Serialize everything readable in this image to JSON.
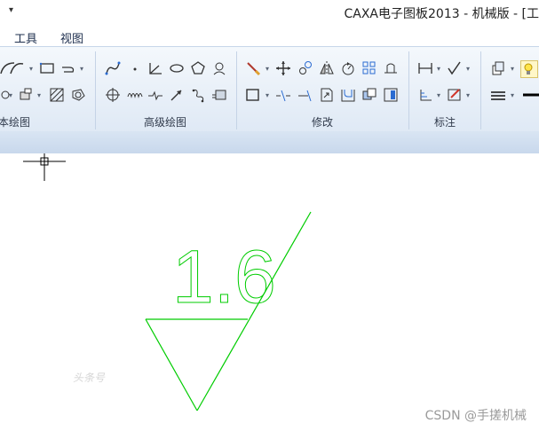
{
  "app": {
    "title": "CAXA电子图板2013 - 机械版 - [工",
    "quick_access": "▾"
  },
  "menu": {
    "items": [
      "工具",
      "视图"
    ]
  },
  "ribbon": {
    "groups": [
      "本绘图",
      "高级绘图",
      "修改",
      "标注"
    ]
  },
  "drawing": {
    "roughness_value": "1.6"
  },
  "watermarks": {
    "left": "头条号",
    "bottom_right": "CSDN @手搓机械"
  },
  "colors": {
    "drawing_green": "#00cc00",
    "ribbon_bg": "#e6eef8",
    "crosshair": "#000000"
  }
}
